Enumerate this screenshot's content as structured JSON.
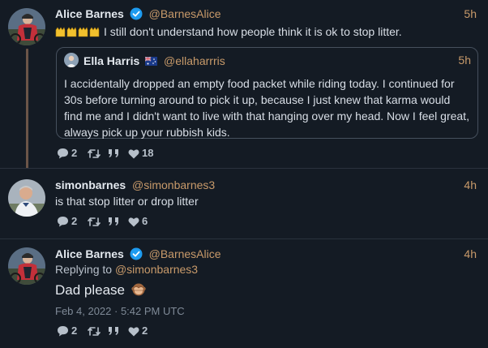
{
  "tweets": [
    {
      "author_name": "Alice Barnes",
      "verified": true,
      "handle": "@BarnesAlice",
      "time": "5h",
      "text": "I still don't understand how people think it is ok to stop litter.",
      "quote": {
        "author_name": "Ella Harris",
        "handle": "@ellaharrris",
        "time": "5h",
        "text": "I accidentally dropped an empty food packet while riding today. I continued for 30s before turning around to pick it up, because I just knew that karma would find me and I didn't want to live with that hanging over my head. Now I feel great, always pick up your rubbish kids."
      },
      "replies": "2",
      "likes": "18"
    },
    {
      "author_name": "simonbarnes",
      "verified": false,
      "handle": "@simonbarnes3",
      "time": "4h",
      "text": "is that stop litter or drop litter",
      "replies": "2",
      "likes": "6"
    },
    {
      "author_name": "Alice Barnes",
      "verified": true,
      "handle": "@BarnesAlice",
      "time": "4h",
      "reply_prefix": "Replying to ",
      "reply_handle": "@simonbarnes3",
      "text": "Dad please",
      "date": "Feb 4, 2022 · 5:42 PM UTC",
      "replies": "2",
      "likes": "2"
    }
  ],
  "icons": {
    "reply": "speech-bubble-icon",
    "retweet": "retweet-icon",
    "quote": "quote-icon",
    "like": "heart-icon",
    "verified": "verified-check-icon"
  },
  "colors": {
    "background": "#141b24",
    "accent": "#c89a6a",
    "verified": "#1d9bf0",
    "thread_line": "#6b5548"
  }
}
